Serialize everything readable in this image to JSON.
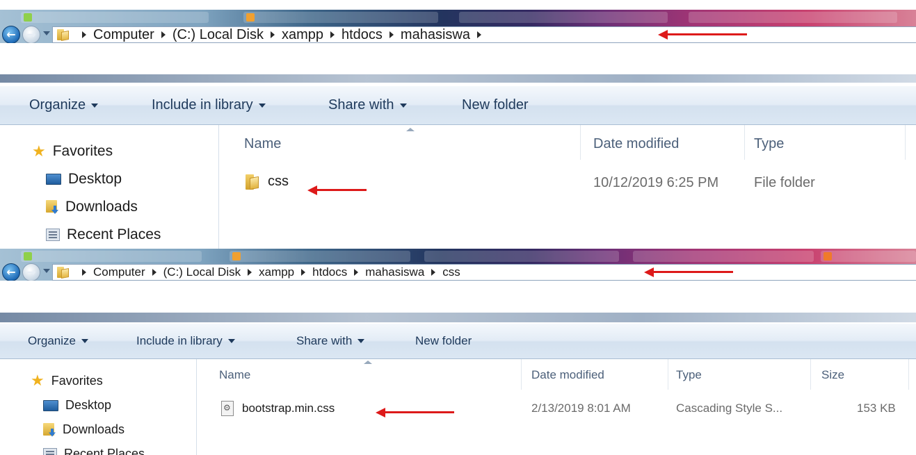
{
  "windows": [
    {
      "breadcrumb": [
        "Computer",
        "(C:) Local Disk",
        "xampp",
        "htdocs",
        "mahasiswa"
      ],
      "toolbar": {
        "organize": "Organize",
        "include_in_library": "Include in library",
        "share_with": "Share with",
        "new_folder": "New folder"
      },
      "nav": {
        "favorites": "Favorites",
        "desktop": "Desktop",
        "downloads": "Downloads",
        "recent_places": "Recent Places"
      },
      "columns": {
        "name": "Name",
        "date_modified": "Date modified",
        "type": "Type"
      },
      "file": {
        "name": "css",
        "date_modified": "10/12/2019 6:25 PM",
        "type": "File folder",
        "icon": "folder-icon"
      }
    },
    {
      "breadcrumb": [
        "Computer",
        "(C:) Local Disk",
        "xampp",
        "htdocs",
        "mahasiswa",
        "css"
      ],
      "toolbar": {
        "organize": "Organize",
        "include_in_library": "Include in library",
        "share_with": "Share with",
        "new_folder": "New folder"
      },
      "nav": {
        "favorites": "Favorites",
        "desktop": "Desktop",
        "downloads": "Downloads",
        "recent_places": "Recent Places"
      },
      "columns": {
        "name": "Name",
        "date_modified": "Date modified",
        "type": "Type",
        "size": "Size"
      },
      "file": {
        "name": "bootstrap.min.css",
        "date_modified": "2/13/2019 8:01 AM",
        "type": "Cascading Style S...",
        "size": "153 KB",
        "icon": "css-file-icon"
      }
    }
  ],
  "colors": {
    "annotation_arrow": "#dd1a1a",
    "toolbar_text": "#1e395b",
    "header_text": "#4c607a"
  }
}
